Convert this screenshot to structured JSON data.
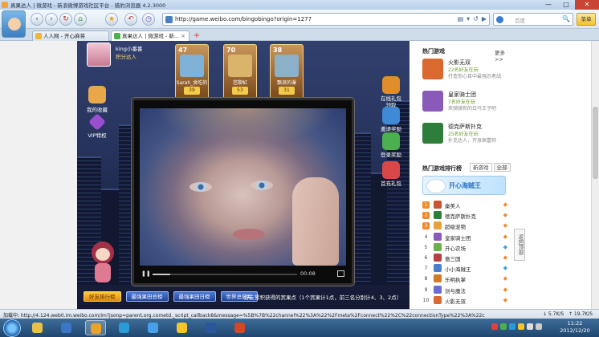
{
  "window": {
    "title": "真果达人 | 微游戏 - 新浪微博游戏社区平台 - 猎豹浏览器 4.2.3000",
    "controls": [
      "—",
      "□",
      "✕"
    ]
  },
  "toolbar": {
    "back": "‹",
    "forward": "›",
    "refresh": "↻",
    "home": "⌂",
    "favorite": "★",
    "undo": "↶",
    "history": "◷",
    "url": "http://game.weibo.com/bingobingo?origin=1277",
    "url_icons": [
      "▤",
      "▾",
      "↺",
      "▶"
    ],
    "search_placeholder": "百度",
    "search_go": "🔍",
    "menu_label": "菜单"
  },
  "tabs": [
    {
      "label": "人人网 - 开心麻将",
      "active": false,
      "color": "#f2b33a"
    },
    {
      "label": "真果达人 | 微游戏 - 新...",
      "active": true,
      "color": "#4caf50"
    }
  ],
  "newtab_label": "+",
  "game": {
    "player_name": "king小番番",
    "player_level": "积分达人",
    "left_icons": [
      {
        "label": "我的收藏",
        "color": "#e8a84a"
      },
      {
        "label": "VIP特权",
        "color": "#9a4fd1"
      }
    ],
    "friends": [
      {
        "level": "47",
        "name": "Sarah_食吃的猫",
        "coins": "39",
        "color": "#7fb2d6"
      },
      {
        "level": "70",
        "name": "芭黎虹",
        "coins": "53",
        "color": "#d9b46a"
      },
      {
        "level": "38",
        "name": "飘浪的瀑",
        "coins": "31",
        "color": "#8cb0c8"
      }
    ],
    "right_icons": [
      {
        "label": "在线礼包",
        "sub": "领取",
        "color": "#e28d2c"
      },
      {
        "label": "邀请奖励",
        "color": "#3f8ad6"
      },
      {
        "label": "登录奖励",
        "color": "#4caf50"
      },
      {
        "label": "首充礼包",
        "color": "#d94848"
      }
    ],
    "video": {
      "time": "00:08",
      "progress": 0.12
    },
    "buttons": [
      {
        "label": "好友排行榜",
        "style": "y"
      },
      {
        "label": "最强果田总榜",
        "style": "b"
      },
      {
        "label": "最强果田日榜",
        "style": "b"
      },
      {
        "label": "世界总冠军",
        "style": "b"
      }
    ],
    "ticker": "好友累积获得的宾果点（1个宾果计1点，前三名分别计4、3、2点）"
  },
  "rpanel": {
    "hot_title": "热门游戏",
    "more": "更多>>",
    "hot_games": [
      {
        "name": "火影无双",
        "count": "22名好友在玩",
        "desc": "打造你心目中最强忍者战",
        "color": "#d9692e"
      },
      {
        "name": "皇家骑士团",
        "count": "7名好友在玩",
        "desc": "来骑骑你的白马王子吧",
        "color": "#8a5ab8"
      },
      {
        "name": "德克萨斯扑克",
        "count": "25名好友在玩",
        "desc": "扑克达人，齐身高富帅",
        "color": "#2f7d3a"
      }
    ],
    "rank_title": "热门游戏排行榜",
    "rank_tabs": [
      "新游戏",
      "全部"
    ],
    "banner_text": "开心海贼王",
    "ranks": [
      {
        "n": "1",
        "name": "秦美人",
        "color": "#c9542f",
        "arrow": "◆",
        "acolor": "#f08a2a"
      },
      {
        "n": "2",
        "name": "德克萨斯扑克",
        "color": "#2f7d3a",
        "arrow": "◆",
        "acolor": "#f08a2a"
      },
      {
        "n": "3",
        "name": "超级宠物",
        "color": "#e7a23a",
        "arrow": "◆",
        "acolor": "#f08a2a"
      },
      {
        "n": "4",
        "name": "皇家骑士团",
        "color": "#8a5ab8",
        "arrow": "◆",
        "acolor": "#f08a2a"
      },
      {
        "n": "5",
        "name": "开心农场",
        "color": "#6bb04a",
        "arrow": "◆",
        "acolor": "#3aa0e0"
      },
      {
        "n": "6",
        "name": "傲三国",
        "color": "#b54040",
        "arrow": "◆",
        "acolor": "#f08a2a"
      },
      {
        "n": "7",
        "name": "小小海贼王",
        "color": "#4a7fd0",
        "arrow": "◆",
        "acolor": "#3aa0e0"
      },
      {
        "n": "8",
        "name": "乐明执掌",
        "color": "#d07a2a",
        "arrow": "◆",
        "acolor": "#f08a2a"
      },
      {
        "n": "9",
        "name": "剑与魔法",
        "color": "#6a6ad0",
        "arrow": "◆",
        "acolor": "#f08a2a"
      },
      {
        "n": "10",
        "name": "火影无双",
        "color": "#d9692e",
        "arrow": "◆",
        "acolor": "#f08a2a"
      }
    ],
    "side_tab": "返回顶部"
  },
  "status": {
    "text": "加载中: http://4.124.web0.im.weibo.com/im?jsonp=parent.org.cometd._script_callback8&message=%5B%7B%22channel%22%3A%22%2Fmeta%2Fconnect%22%2C%22connectionType%22%3A%22callback-polling%22%2C",
    "down": "↓ 5.7K/S",
    "up": "↑ 19.7K/S"
  },
  "taskbar": {
    "apps": [
      {
        "color": "#e9c14a",
        "on": false
      },
      {
        "color": "#3a76c5",
        "on": false
      },
      {
        "color": "#e8a32a",
        "on": true
      },
      {
        "color": "#2a9bd8",
        "on": false
      },
      {
        "color": "#48a1e8",
        "on": false
      },
      {
        "color": "#f5c52e",
        "on": false
      },
      {
        "color": "#2b579a",
        "on": false
      },
      {
        "color": "#d24726",
        "on": false
      }
    ],
    "time": "11:22",
    "date": "2012/12/20"
  }
}
